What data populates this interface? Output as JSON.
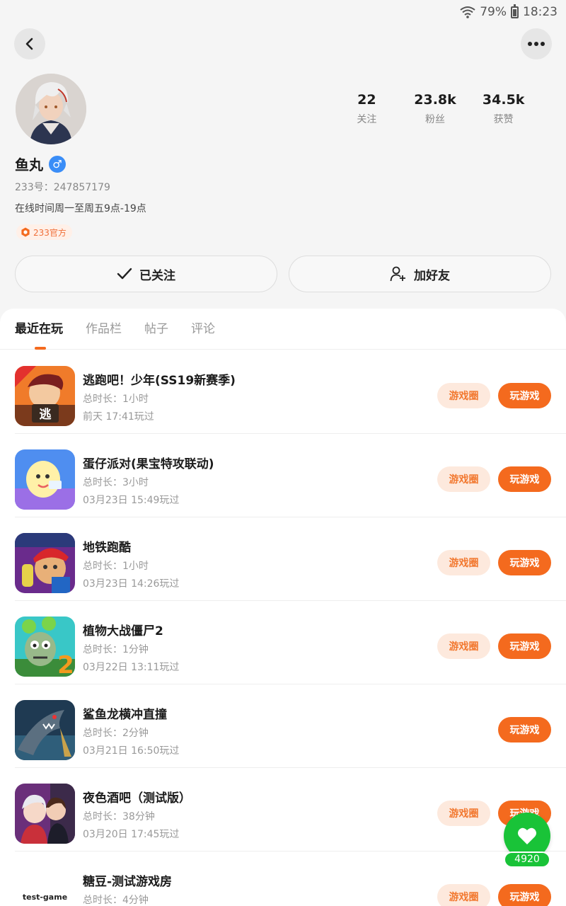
{
  "status_bar": {
    "battery": "79%",
    "time": "18:23"
  },
  "profile": {
    "name": "鱼丸",
    "gender_symbol": "♂",
    "uid": "233号：247857179",
    "bio": "在线时间周一至周五9点-19点",
    "badge": "233官方",
    "stats": [
      {
        "value": "22",
        "label": "关注"
      },
      {
        "value": "23.8k",
        "label": "粉丝"
      },
      {
        "value": "34.5k",
        "label": "获赞"
      }
    ],
    "follow_label": "已关注",
    "add_friend_label": "加好友"
  },
  "tabs": [
    {
      "label": "最近在玩",
      "active": true
    },
    {
      "label": "作品栏",
      "active": false
    },
    {
      "label": "帖子",
      "active": false
    },
    {
      "label": "评论",
      "active": false
    }
  ],
  "games": [
    {
      "title": "逃跑吧！少年(SS19新赛季)",
      "duration": "总时长：1小时",
      "last_played": "前天 17:41玩过",
      "circle_label": "游戏圈",
      "play_label": "玩游戏",
      "has_circle": true
    },
    {
      "title": "蛋仔派对(果宝特攻联动)",
      "duration": "总时长：3小时",
      "last_played": "03月23日 15:49玩过",
      "circle_label": "游戏圈",
      "play_label": "玩游戏",
      "has_circle": true
    },
    {
      "title": "地铁跑酷",
      "duration": "总时长：1小时",
      "last_played": "03月23日 14:26玩过",
      "circle_label": "游戏圈",
      "play_label": "玩游戏",
      "has_circle": true
    },
    {
      "title": "植物大战僵尸2",
      "duration": "总时长：1分钟",
      "last_played": "03月22日 13:11玩过",
      "circle_label": "游戏圈",
      "play_label": "玩游戏",
      "has_circle": true
    },
    {
      "title": "鲨鱼龙横冲直撞",
      "duration": "总时长：2分钟",
      "last_played": "03月21日 16:50玩过",
      "circle_label": "",
      "play_label": "玩游戏",
      "has_circle": false
    },
    {
      "title": "夜色酒吧（测试版）",
      "duration": "总时长：38分钟",
      "last_played": "03月20日 17:45玩过",
      "circle_label": "游戏圈",
      "play_label": "玩游戏",
      "has_circle": true
    },
    {
      "title": "糖豆-测试游戏房",
      "duration": "总时长：4分钟",
      "last_played": "",
      "circle_label": "游戏圈",
      "play_label": "玩游戏",
      "has_circle": true,
      "icon_text": "test-game"
    }
  ],
  "like": {
    "count": "4920"
  },
  "colors": {
    "accent": "#f46a1e",
    "circle_bg": "#fde9dd",
    "like_green": "#19c338"
  }
}
